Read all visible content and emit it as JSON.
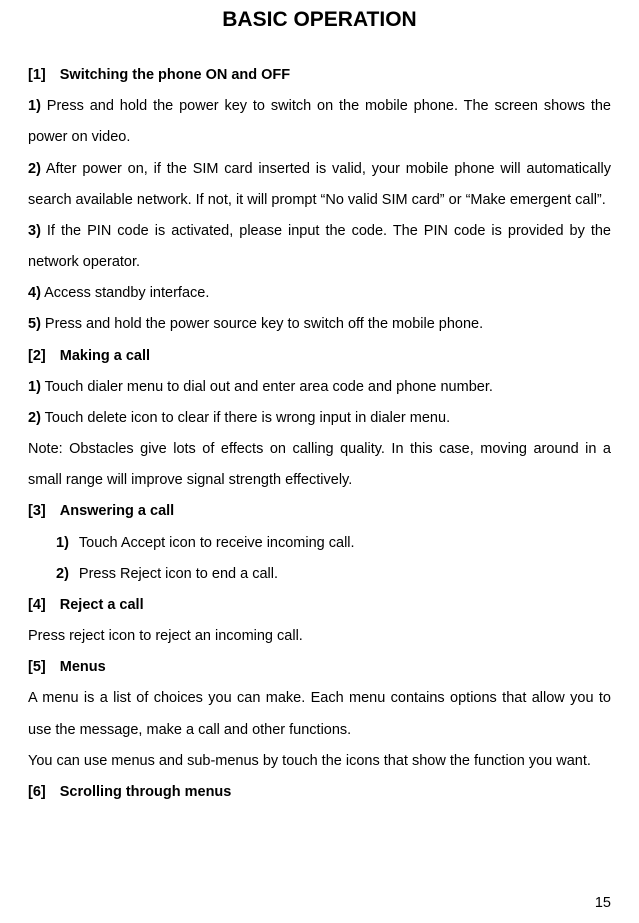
{
  "title": "BASIC OPERATION",
  "s1": {
    "num": "[1]",
    "head": "Switching the phone ON and OFF",
    "i1b": "1)",
    "i1": " Press and hold the power key to switch on the mobile phone. The screen shows the power on video.",
    "i2b": "2)",
    "i2": " After power on, if the SIM card inserted is valid, your mobile phone will automatically search available network. If not, it will prompt “No valid SIM card” or “Make emergent call”.",
    "i3b": "3)",
    "i3": " If the PIN code is activated, please input the code. The PIN code is provided by the network operator.",
    "i4b": "4)",
    "i4": " Access standby interface.",
    "i5b": "5)",
    "i5": " Press and hold the power source key to switch off the mobile phone."
  },
  "s2": {
    "num": "[2]",
    "head": "Making a call",
    "i1b": "1)",
    "i1": " Touch dialer menu to dial out and enter area code and phone number.",
    "i2b": "2)",
    "i2": " Touch delete icon to clear if there is wrong input in dialer menu.",
    "note": "Note: Obstacles give lots of effects on calling quality. In this case, moving around in a small range will improve signal strength effectively."
  },
  "s3": {
    "num": "[3]",
    "head": "Answering a call",
    "i1b": "1)",
    "i1": "Touch Accept icon to receive incoming call.",
    "i2b": "2)",
    "i2": "Press Reject icon to end a call."
  },
  "s4": {
    "num": "[4]",
    "head": "Reject a call",
    "body": "Press reject icon to reject an incoming call."
  },
  "s5": {
    "num": "[5]",
    "head": "Menus",
    "p1": "A menu is a list of choices you can make. Each menu contains options that allow you to use the message, make a call and other functions.",
    "p2": "You can use menus and sub-menus by touch the icons that show the function you want."
  },
  "s6": {
    "num": "[6]",
    "head": "Scrolling through menus"
  },
  "pageNumber": "15"
}
